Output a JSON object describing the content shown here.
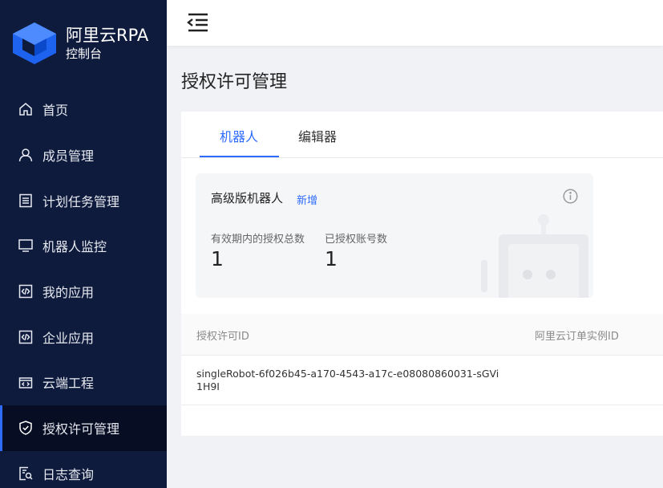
{
  "sidebar": {
    "logo": {
      "title": "阿里云RPA",
      "subtitle": "控制台",
      "icon": "aliyun-rpa-logo"
    },
    "items": [
      {
        "label": "首页",
        "icon": "home-icon"
      },
      {
        "label": "成员管理",
        "icon": "user-icon"
      },
      {
        "label": "计划任务管理",
        "icon": "list-icon"
      },
      {
        "label": "机器人监控",
        "icon": "monitor-icon"
      },
      {
        "label": "我的应用",
        "icon": "code-file-icon"
      },
      {
        "label": "企业应用",
        "icon": "code-file-icon"
      },
      {
        "label": "云端工程",
        "icon": "cloud-code-icon"
      },
      {
        "label": "授权许可管理",
        "icon": "shield-check-icon",
        "active": true
      },
      {
        "label": "日志查询",
        "icon": "log-search-icon"
      }
    ]
  },
  "header": {
    "menu_icon": "menu-fold-icon"
  },
  "page": {
    "title": "授权许可管理"
  },
  "tabs": [
    {
      "label": "机器人",
      "active": true
    },
    {
      "label": "编辑器"
    }
  ],
  "panel": {
    "title": "高级版机器人",
    "add_label": "新增",
    "stats": [
      {
        "label": "有效期内的授权总数",
        "value": "1"
      },
      {
        "label": "已授权账号数",
        "value": "1"
      }
    ]
  },
  "table": {
    "columns": [
      "授权许可ID",
      "阿里云订单实例ID"
    ],
    "rows": [
      {
        "license_id": "singleRobot-6f026b45-a170-4543-a17c-e08080860031-sGVi1H9I",
        "order_id": ""
      }
    ]
  },
  "colors": {
    "sidebar_bg": "#0f1b3d",
    "accent": "#2f6bff",
    "page_bg": "#f0f2f5"
  }
}
